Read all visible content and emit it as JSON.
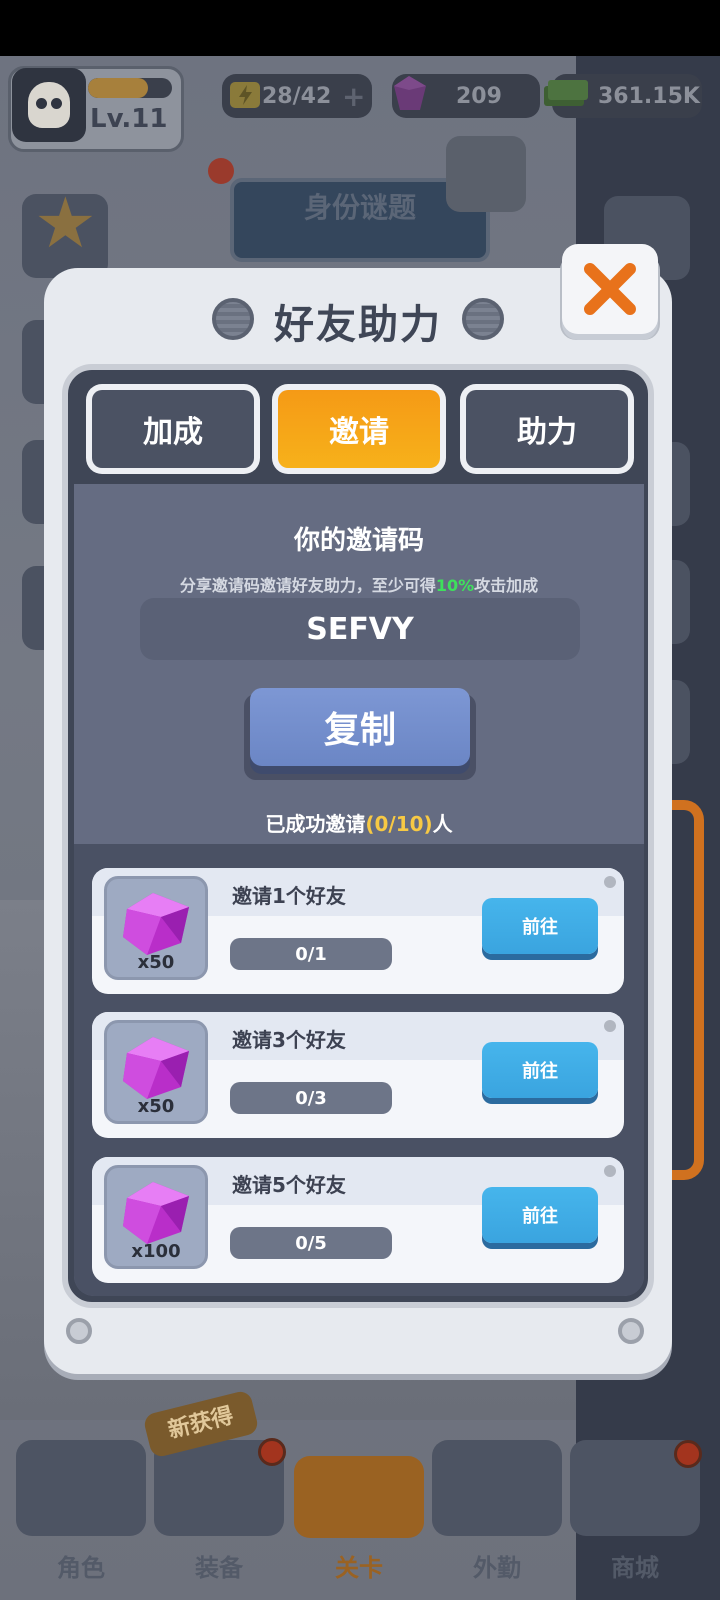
{
  "hud": {
    "level": "Lv.11",
    "xp_fraction": 0.72,
    "energy": "28/42",
    "gems": "209",
    "cash": "361.15K"
  },
  "stage": {
    "title": "身份谜题"
  },
  "modal": {
    "title": "好友助力",
    "tabs": [
      "加成",
      "邀请",
      "助力"
    ],
    "active_tab": "邀请",
    "code_title": "你的邀请码",
    "code_desc_prefix": "分享邀请码邀请好友助力，至少可得",
    "code_desc_highlight": "10%",
    "code_desc_suffix": "攻击加成",
    "invite_code": "SEFVY",
    "copy_label": "复制",
    "invited_prefix": "已成功邀请",
    "invited_count": "(0/10)",
    "invited_suffix": "人",
    "tasks": [
      {
        "name": "邀请1个好友",
        "reward_qty": "x50",
        "progress": "0/1",
        "progress_fraction": 0,
        "go_label": "前往",
        "reward_icon": "gem-icon"
      },
      {
        "name": "邀请3个好友",
        "reward_qty": "x50",
        "progress": "0/3",
        "progress_fraction": 0,
        "go_label": "前往",
        "reward_icon": "gem-icon"
      },
      {
        "name": "邀请5个好友",
        "reward_qty": "x100",
        "progress": "0/5",
        "progress_fraction": 0,
        "go_label": "前往",
        "reward_icon": "gem-icon"
      }
    ]
  },
  "bottom_nav": {
    "items": [
      "角色",
      "装备",
      "关卡",
      "外勤",
      "商城"
    ],
    "active": "关卡",
    "new_badge": "新获得"
  },
  "colors": {
    "accent_orange": "#f7a51a",
    "progress_highlight_green": "#3ee05c",
    "invite_count_yellow": "#f7c944",
    "go_button_blue": "#3aa4df",
    "copy_button_blue": "#7390cd",
    "close_x_orange": "#e8721b"
  }
}
